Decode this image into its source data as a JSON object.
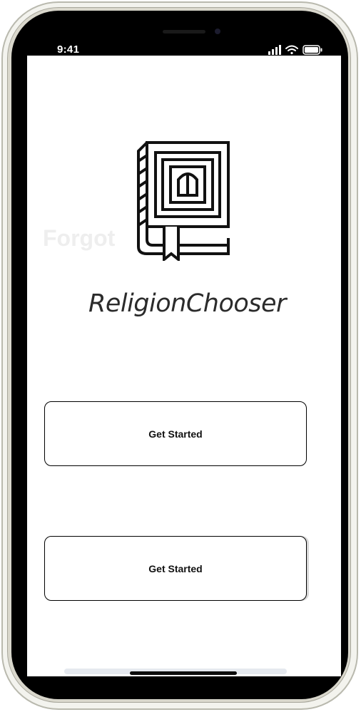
{
  "status_bar": {
    "time": "9:41"
  },
  "background_ghost_text": "Forgot",
  "app": {
    "name": "ReligionChooser"
  },
  "buttons": [
    {
      "label": "Get Started"
    },
    {
      "label": "Get Started"
    }
  ],
  "icons": {
    "logo": "book-icon",
    "signal": "cellular-signal-icon",
    "wifi": "wifi-icon",
    "battery": "battery-icon"
  },
  "colors": {
    "screen_bg": "#ffffff",
    "bezel": "#000000",
    "frame": "#d9d7cc",
    "button_border": "#000000",
    "text": "#111111"
  }
}
